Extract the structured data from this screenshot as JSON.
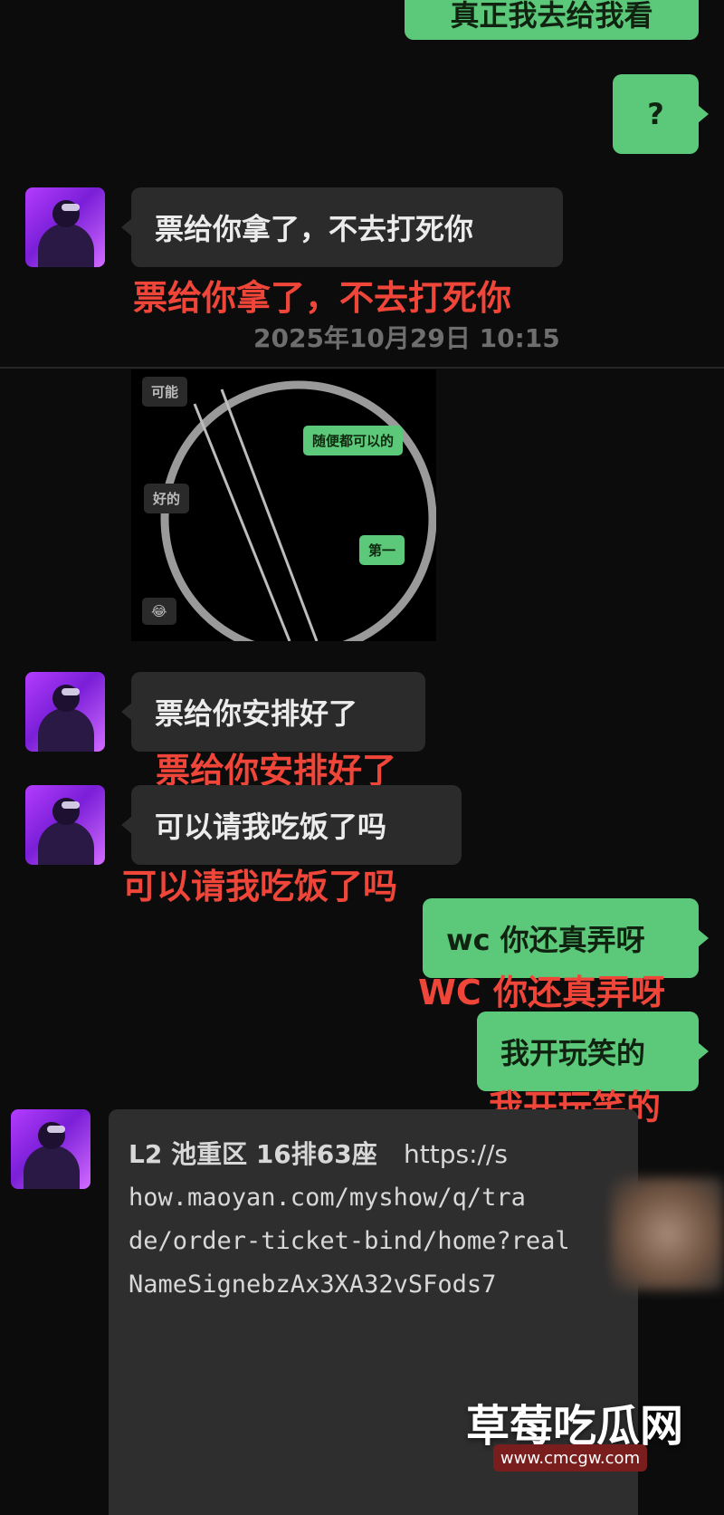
{
  "messages": {
    "top_partial": "真正我去给我看",
    "question": "?",
    "msg1": "票给你拿了，不去打死你",
    "msg1_caption": "票给你拿了，不去打死你",
    "timestamp": "2025年10月29日 10:15",
    "embedded": {
      "bubble_top_left": "可能",
      "bubble_right_1": "随便都可以的",
      "bubble_left_mid": "好的",
      "bubble_right_2": "第一",
      "emoji": "😂"
    },
    "msg2": "票给你安排好了",
    "msg2_caption": "票给你安排好了",
    "msg3": "可以请我吃饭了吗",
    "msg3_caption": "可以请我吃饭了吗",
    "msg4": "wc 你还真弄呀",
    "msg4_caption": "WC 你还真弄呀",
    "msg5": "我开玩笑的",
    "msg5_caption": "我开玩笑的",
    "link_lines": [
      "L2 池重区 16排63座",
      "how.maoyan.com/myshow/q/tra",
      "de/order-ticket-bind/home?real",
      "NameSignebzAx3XA32vSFods7"
    ],
    "link_prefix": "https://s"
  },
  "watermark": {
    "title": "草莓吃瓜网",
    "url": "www.cmcgw.com"
  },
  "colors": {
    "background": "#0c0c0c",
    "incoming_bubble": "#2b2b2b",
    "outgoing_bubble": "#5cc97a",
    "caption_red": "#f0463a"
  }
}
